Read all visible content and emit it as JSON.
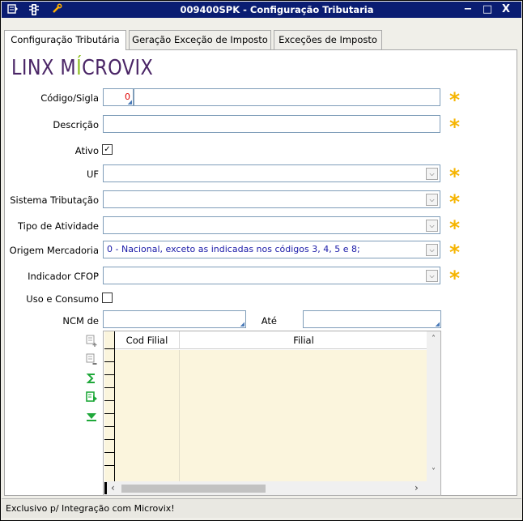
{
  "window": {
    "title": "009400SPK - Configuração Tributaria",
    "minimize": "−",
    "maximize": "□",
    "close": "X"
  },
  "tabs": [
    {
      "label": "Configuração Tributária",
      "active": true
    },
    {
      "label": "Geração Exceção de Imposto",
      "active": false
    },
    {
      "label": "Exceções de Imposto",
      "active": false
    }
  ],
  "logo": {
    "part1": "LINX M",
    "accent": "Í",
    "part2": "CROVIX"
  },
  "form": {
    "codigo": {
      "label": "Código/Sigla",
      "value": "0"
    },
    "descricao": {
      "label": "Descrição",
      "value": ""
    },
    "ativo": {
      "label": "Ativo",
      "checked": true,
      "check_glyph": "✓"
    },
    "uf": {
      "label": "UF",
      "value": ""
    },
    "sistema": {
      "label": "Sistema Tributação",
      "value": ""
    },
    "tipo": {
      "label": "Tipo de Atividade",
      "value": ""
    },
    "origem": {
      "label": "Origem Mercadoria",
      "value": "0   - Nacional, exceto as indicadas nos códigos 3, 4, 5 e 8;"
    },
    "cfop": {
      "label": "Indicador CFOP",
      "value": ""
    },
    "uso": {
      "label": "Uso e Consumo",
      "checked": false
    },
    "ncm_de": {
      "label": "NCM de",
      "value": ""
    },
    "ncm_ate": {
      "label": "Até",
      "value": ""
    },
    "required_glyph": "*",
    "dropdown_glyph": "⌵"
  },
  "grid": {
    "columns": [
      "Cod Filial",
      "Filial"
    ],
    "scroll_up": "˄",
    "scroll_down": "˅",
    "scroll_left": "‹",
    "scroll_right": "›"
  },
  "colors": {
    "titlebar": "#0a1d72",
    "required": "#f5b400",
    "grid_bg": "#fbf5dd",
    "logo": "#4a2566",
    "logo_accent": "#8cbd1f"
  },
  "status": {
    "text": "Exclusivo p/ Integração com Microvix!"
  }
}
